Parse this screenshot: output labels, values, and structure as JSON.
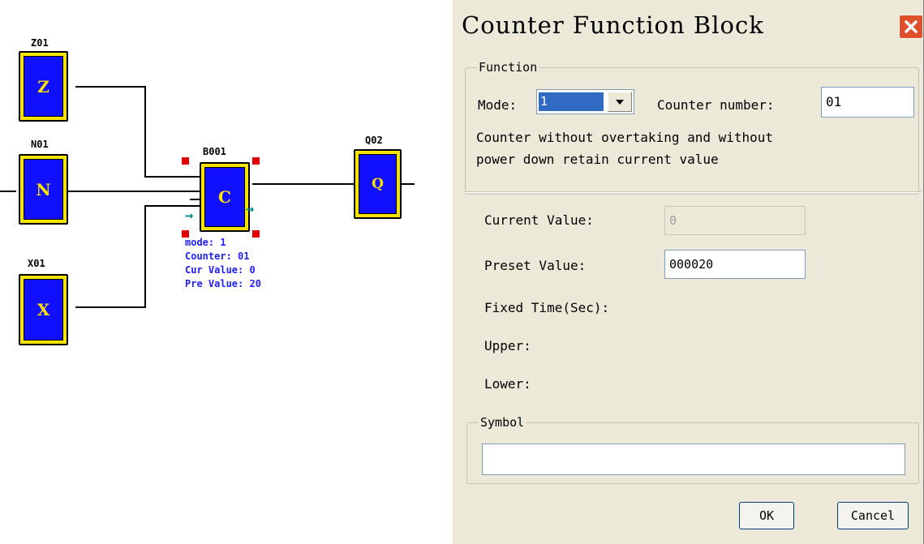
{
  "diagram": {
    "blocks": [
      {
        "id": "Z01",
        "letter": "Z"
      },
      {
        "id": "N01",
        "letter": "N"
      },
      {
        "id": "X01",
        "letter": "X"
      },
      {
        "id": "B001",
        "letter": "C"
      },
      {
        "id": "Q02",
        "letter": "Q"
      }
    ],
    "info": {
      "mode": "mode: 1",
      "counter": "Counter: 01",
      "cur_value": "Cur Value: 0",
      "pre_value": "Pre Value: 20"
    }
  },
  "dialog": {
    "title": "Counter Function Block",
    "function_group": {
      "legend": "Function",
      "mode_label": "Mode:",
      "mode_value": "1",
      "counter_number_label": "Counter number:",
      "counter_number_value": "01",
      "description_line1": "Counter without overtaking and without",
      "description_line2": "power down retain current value"
    },
    "values": {
      "current_value_label": "Current Value:",
      "current_value": "0",
      "preset_value_label": "Preset Value:",
      "preset_value": "000020",
      "fixed_time_label": "Fixed Time(Sec):",
      "upper_label": "Upper:",
      "lower_label": "Lower:"
    },
    "symbol_group": {
      "legend": "Symbol",
      "value": ""
    },
    "buttons": {
      "ok": "OK",
      "cancel": "Cancel"
    }
  },
  "colors": {
    "block_fill": "#1010ff",
    "block_border": "#f5e400",
    "block_letter": "#ffe000",
    "info_text": "#2020ff",
    "handle": "#e00000",
    "dialog_bg": "#ece9d8",
    "close_button": "#e0512b"
  }
}
